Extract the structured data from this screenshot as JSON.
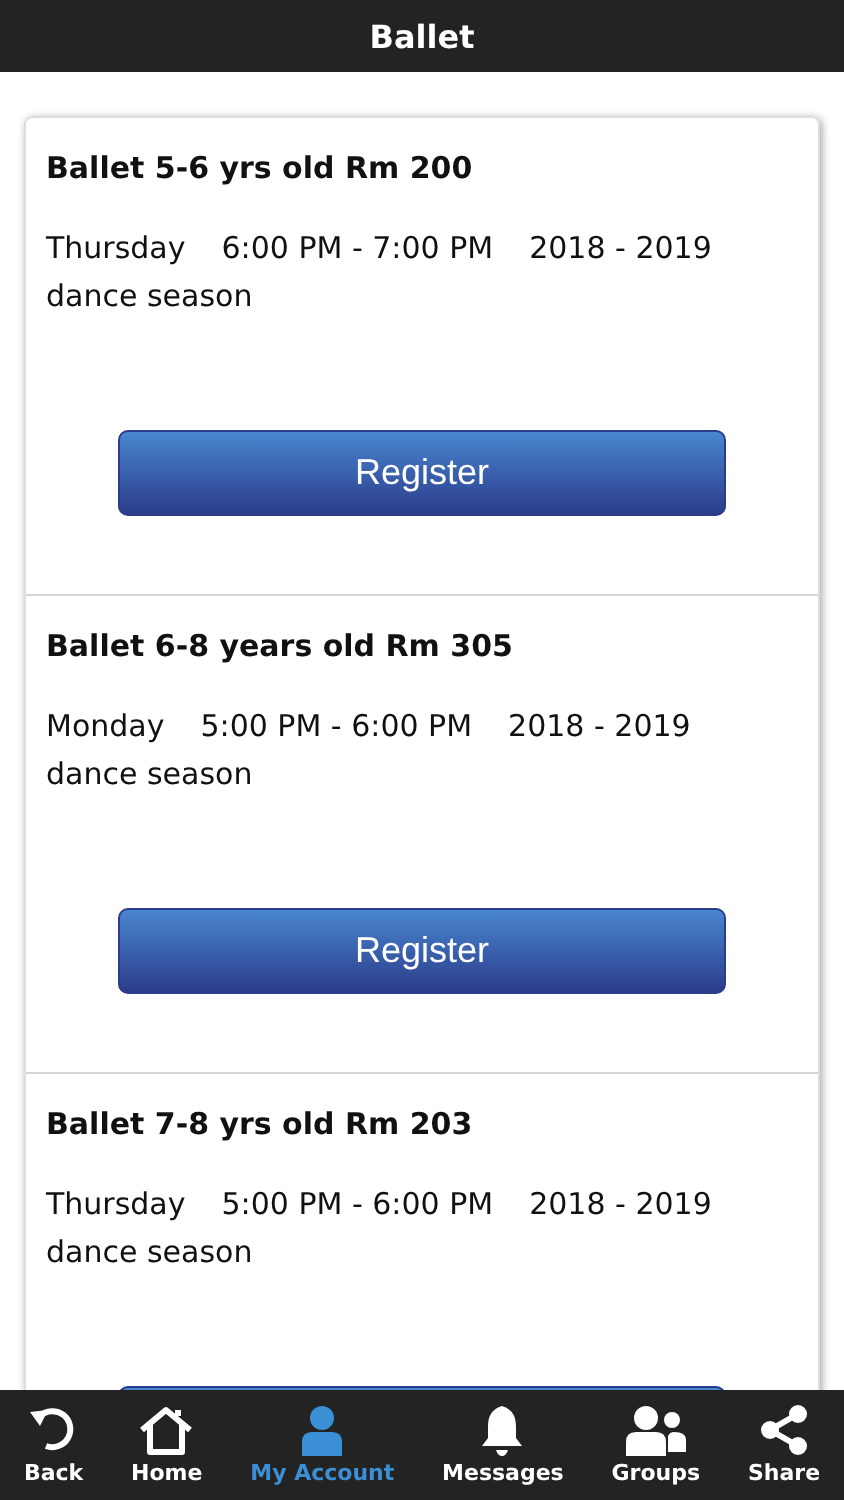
{
  "header": {
    "title": "Ballet"
  },
  "classes": [
    {
      "title": "Ballet 5-6 yrs old Rm 200",
      "day": "Thursday",
      "time": "6:00 PM - 7:00 PM",
      "season": "2018 - 2019",
      "season_2": "dance season",
      "button": "Register"
    },
    {
      "title": "Ballet 6-8 years old Rm 305",
      "day": "Monday",
      "time": "5:00 PM - 6:00 PM",
      "season": "2018 - 2019",
      "season_2": "dance season",
      "button": "Register"
    },
    {
      "title": "Ballet 7-8 yrs old Rm 203",
      "day": "Thursday",
      "time": "5:00 PM - 6:00 PM",
      "season": "2018 - 2019",
      "season_2": "dance season"
    }
  ],
  "tabs": [
    {
      "kind": "back",
      "label": "Back",
      "selected": false
    },
    {
      "kind": "home",
      "label": "Home",
      "selected": false
    },
    {
      "kind": "account",
      "label": "My Account",
      "selected": true
    },
    {
      "kind": "messages",
      "label": "Messages",
      "selected": false
    },
    {
      "kind": "groups",
      "label": "Groups",
      "selected": false
    },
    {
      "kind": "share",
      "label": "Share",
      "selected": false
    }
  ]
}
